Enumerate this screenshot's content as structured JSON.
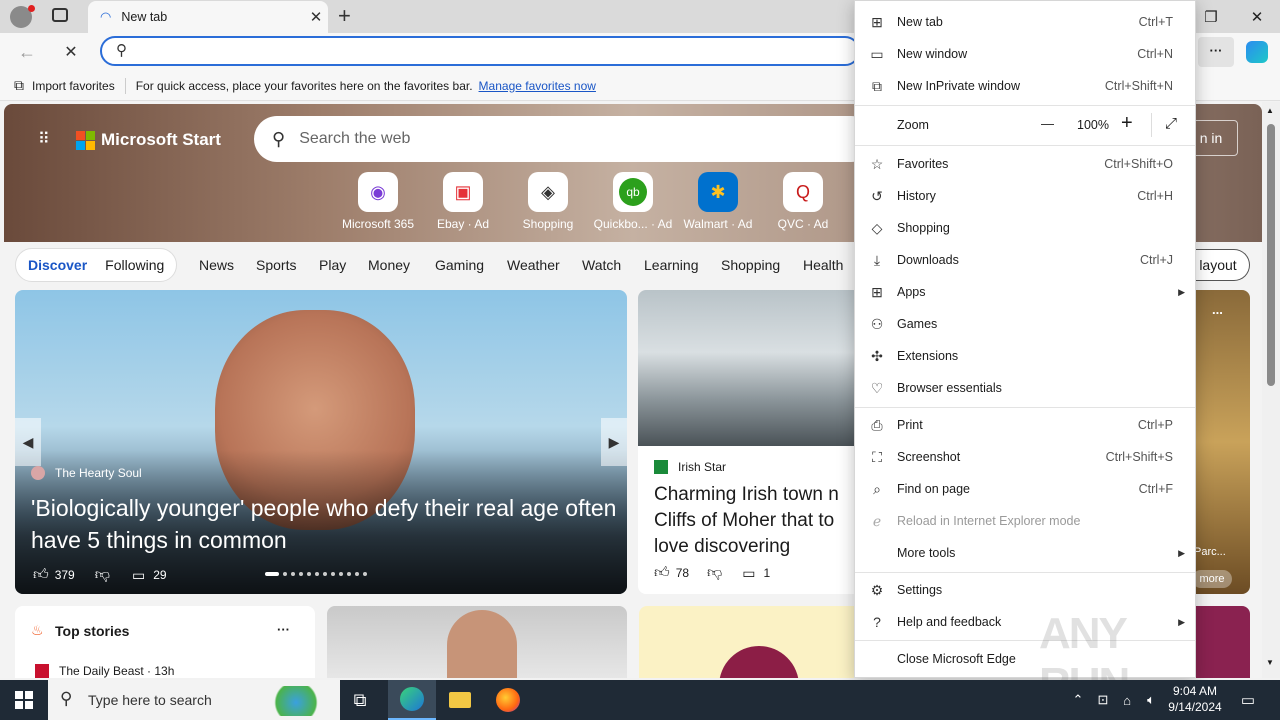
{
  "browser": {
    "tab_title": "New tab",
    "tab_close": "✕",
    "new_tab": "+",
    "address_value": "",
    "favbar_import": "Import favorites",
    "favbar_text": "For quick access, place your favorites here on the favorites bar.",
    "favbar_link": "Manage favorites now",
    "more_btn": "···"
  },
  "page": {
    "brand": "Microsoft Start",
    "search_placeholder": "Search the web",
    "signin": "n in",
    "quicklinks": [
      {
        "label": "Microsoft 365"
      },
      {
        "label": "Ebay · Ad"
      },
      {
        "label": "Shopping"
      },
      {
        "label": "Quickbo... · Ad"
      },
      {
        "label": "Walmart · Ad"
      },
      {
        "label": "QVC · Ad"
      }
    ],
    "tabs": {
      "discover": "Discover",
      "following": "Following"
    },
    "nav": [
      "News",
      "Sports",
      "Play",
      "Money",
      "Gaming",
      "Weather",
      "Watch",
      "Learning",
      "Shopping",
      "Health"
    ],
    "layout_btn": "l layout",
    "card1": {
      "source": "The Hearty Soul",
      "headline": "'Biologically younger' people who defy their real age often have 5 things in common",
      "likes": "379",
      "comments": "29"
    },
    "card2": {
      "source": "Irish Star",
      "headline": "Charming Irish town n Cliffs of Moher that to love discovering",
      "likes": "78",
      "comments": "1"
    },
    "card3": {
      "caption": "Parc...",
      "more": "more",
      "dots": "..."
    },
    "topstories": {
      "title": "Top stories",
      "source": "The Daily Beast · 13h",
      "dots": "···"
    }
  },
  "menu": {
    "items": [
      {
        "icon": "new-tab-icon",
        "label": "New tab",
        "shortcut": "Ctrl+T"
      },
      {
        "icon": "new-window-icon",
        "label": "New window",
        "shortcut": "Ctrl+N"
      },
      {
        "icon": "inprivate-icon",
        "label": "New InPrivate window",
        "shortcut": "Ctrl+Shift+N"
      },
      {
        "icon": "favorites-icon",
        "label": "Favorites",
        "shortcut": "Ctrl+Shift+O"
      },
      {
        "icon": "history-icon",
        "label": "History",
        "shortcut": "Ctrl+H"
      },
      {
        "icon": "shopping-icon",
        "label": "Shopping",
        "shortcut": ""
      },
      {
        "icon": "downloads-icon",
        "label": "Downloads",
        "shortcut": "Ctrl+J"
      },
      {
        "icon": "apps-icon",
        "label": "Apps",
        "shortcut": ""
      },
      {
        "icon": "games-icon",
        "label": "Games",
        "shortcut": ""
      },
      {
        "icon": "extensions-icon",
        "label": "Extensions",
        "shortcut": ""
      },
      {
        "icon": "browser-essentials-icon",
        "label": "Browser essentials",
        "shortcut": ""
      },
      {
        "icon": "print-icon",
        "label": "Print",
        "shortcut": "Ctrl+P"
      },
      {
        "icon": "screenshot-icon",
        "label": "Screenshot",
        "shortcut": "Ctrl+Shift+S"
      },
      {
        "icon": "find-icon",
        "label": "Find on page",
        "shortcut": "Ctrl+F"
      },
      {
        "icon": "ie-icon",
        "label": "Reload in Internet Explorer mode",
        "shortcut": ""
      },
      {
        "icon": "",
        "label": "More tools",
        "shortcut": ""
      },
      {
        "icon": "settings-icon",
        "label": "Settings",
        "shortcut": ""
      },
      {
        "icon": "help-icon",
        "label": "Help and feedback",
        "shortcut": ""
      },
      {
        "icon": "",
        "label": "Close Microsoft Edge",
        "shortcut": ""
      }
    ],
    "zoom_label": "Zoom",
    "zoom_value": "100%",
    "zoom_minus": "—",
    "zoom_plus": "+"
  },
  "taskbar": {
    "search_placeholder": "Type here to search",
    "time": "9:04 AM",
    "date": "9/14/2024"
  },
  "watermark": "ANY RUN"
}
